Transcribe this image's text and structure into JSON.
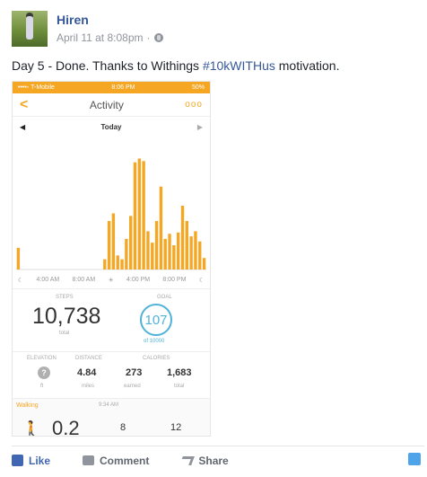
{
  "post": {
    "author": "Hiren",
    "timestamp": "April 11 at 8:08pm",
    "separator": "·",
    "text_before": "Day 5 - Done. Thanks to Withings ",
    "hashtag": "#10kWITHus",
    "text_after": " motivation."
  },
  "phone": {
    "status_carrier": "••••◦ T-Mobile",
    "status_time": "8:06 PM",
    "status_battery": "50%",
    "title": "Activity",
    "day": "Today",
    "back_glyph": "<",
    "prev_glyph": "◀",
    "next_glyph": "▶",
    "more_glyph": "ooo",
    "time_labels": [
      "4:00 AM",
      "8:00 AM",
      "4:00 PM",
      "8:00 PM"
    ],
    "steps_label": "STEPS",
    "steps_value": "10,738",
    "steps_sub": "total",
    "goal_label": "GOAL",
    "goal_value": "107",
    "goal_sub": "of 10000",
    "metrics": [
      {
        "label": "ELEVATION",
        "value": "",
        "sub": "ft"
      },
      {
        "label": "DISTANCE",
        "value": "4.84",
        "sub": "miles"
      },
      {
        "label": "CALORIES",
        "value": "273",
        "sub": "earned"
      },
      {
        "label": "",
        "value": "1,683",
        "sub": "total"
      }
    ],
    "walking_label": "Walking",
    "walking_time": "9:34 AM",
    "walking_value": "0.2",
    "walking_mid": "8",
    "walking_right": "12",
    "accent_color": "#f5a623",
    "goal_color": "#4fb3d9"
  },
  "actions": {
    "like": "Like",
    "comment": "Comment",
    "share": "Share"
  },
  "chart_data": {
    "type": "bar",
    "title": "",
    "values": [
      0.17,
      0,
      0,
      0,
      0,
      0,
      0,
      0,
      0,
      0,
      0,
      0,
      0,
      0,
      0,
      0,
      0,
      0,
      0,
      0,
      0.08,
      0.38,
      0.44,
      0.11,
      0.08,
      0.24,
      0.42,
      0.84,
      0.87,
      0.85,
      0.3,
      0.21,
      0.38,
      0.65,
      0.24,
      0.28,
      0.19,
      0.29,
      0.5,
      0.38,
      0.26,
      0.3,
      0.22,
      0.09
    ],
    "color": "#f5a623",
    "ylim": [
      0,
      1
    ],
    "xlabel": "",
    "ylabel": ""
  }
}
